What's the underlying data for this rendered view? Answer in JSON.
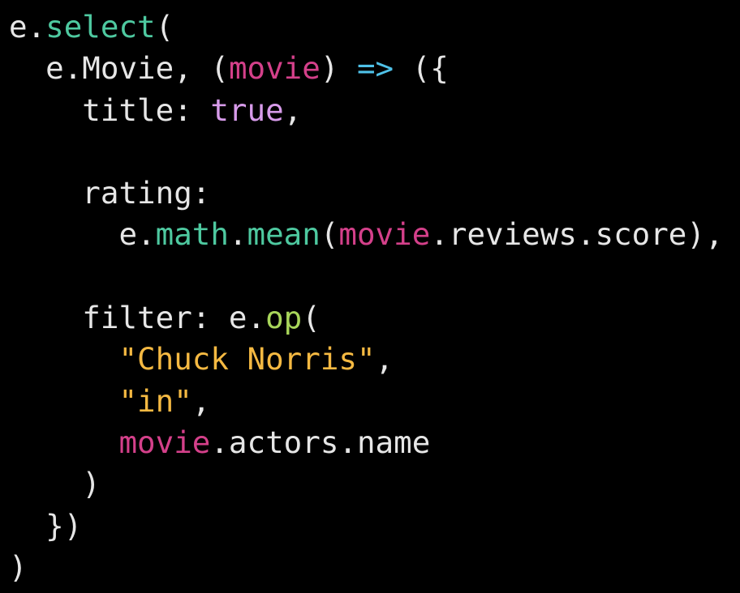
{
  "editor": {
    "background": "#000000",
    "colors": {
      "plain": "#e6e6e6",
      "method": "#4ec9a0",
      "param": "#d4408a",
      "arrow": "#4fc1e8",
      "boolean": "#d79bea",
      "function": "#a8d65a",
      "string": "#f5b942"
    },
    "lines": [
      {
        "tokens": [
          {
            "text": "e.",
            "kind": "plain"
          },
          {
            "text": "select",
            "kind": "method"
          },
          {
            "text": "(",
            "kind": "plain"
          }
        ]
      },
      {
        "tokens": [
          {
            "text": "  e.Movie, (",
            "kind": "plain"
          },
          {
            "text": "movie",
            "kind": "param"
          },
          {
            "text": ") ",
            "kind": "plain"
          },
          {
            "text": "=>",
            "kind": "arrow"
          },
          {
            "text": " ({",
            "kind": "plain"
          }
        ]
      },
      {
        "tokens": [
          {
            "text": "    title: ",
            "kind": "plain"
          },
          {
            "text": "true",
            "kind": "bool"
          },
          {
            "text": ",",
            "kind": "plain"
          }
        ]
      },
      {
        "tokens": []
      },
      {
        "tokens": [
          {
            "text": "    rating:",
            "kind": "plain"
          }
        ]
      },
      {
        "tokens": [
          {
            "text": "      e.",
            "kind": "plain"
          },
          {
            "text": "math",
            "kind": "method"
          },
          {
            "text": ".",
            "kind": "plain"
          },
          {
            "text": "mean",
            "kind": "method"
          },
          {
            "text": "(",
            "kind": "plain"
          },
          {
            "text": "movie",
            "kind": "param"
          },
          {
            "text": ".reviews.score),",
            "kind": "plain"
          }
        ]
      },
      {
        "tokens": []
      },
      {
        "tokens": [
          {
            "text": "    filter: e.",
            "kind": "plain"
          },
          {
            "text": "op",
            "kind": "fn"
          },
          {
            "text": "(",
            "kind": "plain"
          }
        ]
      },
      {
        "tokens": [
          {
            "text": "      ",
            "kind": "plain"
          },
          {
            "text": "\"Chuck Norris\"",
            "kind": "string"
          },
          {
            "text": ",",
            "kind": "plain"
          }
        ]
      },
      {
        "tokens": [
          {
            "text": "      ",
            "kind": "plain"
          },
          {
            "text": "\"in\"",
            "kind": "string"
          },
          {
            "text": ",",
            "kind": "plain"
          }
        ]
      },
      {
        "tokens": [
          {
            "text": "      ",
            "kind": "plain"
          },
          {
            "text": "movie",
            "kind": "param"
          },
          {
            "text": ".actors.name",
            "kind": "plain"
          }
        ]
      },
      {
        "tokens": [
          {
            "text": "    )",
            "kind": "plain"
          }
        ]
      },
      {
        "tokens": [
          {
            "text": "  })",
            "kind": "plain"
          }
        ]
      },
      {
        "tokens": [
          {
            "text": ")",
            "kind": "plain"
          }
        ]
      }
    ]
  }
}
